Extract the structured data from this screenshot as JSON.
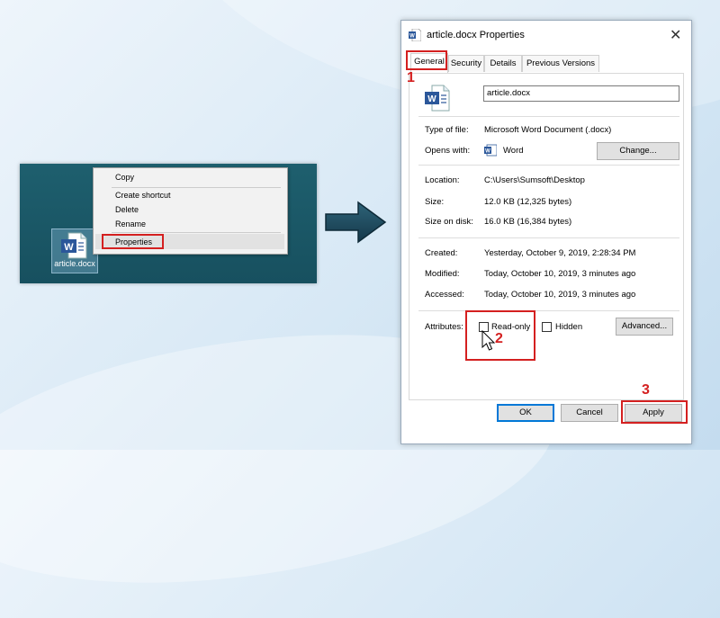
{
  "context_menu": {
    "items": [
      "Copy",
      "Create shortcut",
      "Delete",
      "Rename",
      "Properties"
    ]
  },
  "desktop": {
    "file_label": "article.docx"
  },
  "dialog": {
    "title": "article.docx Properties",
    "close_glyph": "✕",
    "tabs": [
      "General",
      "Security",
      "Details",
      "Previous Versions"
    ],
    "file_name": "article.docx",
    "type_label": "Type of file:",
    "type_value": "Microsoft Word Document (.docx)",
    "opens_label": "Opens with:",
    "opens_value": "Word",
    "change_button": "Change...",
    "location_label": "Location:",
    "location_value": "C:\\Users\\Sumsoft\\Desktop",
    "size_label": "Size:",
    "size_value": "12.0 KB (12,325 bytes)",
    "size_disk_label": "Size on disk:",
    "size_disk_value": "16.0 KB (16,384 bytes)",
    "created_label": "Created:",
    "created_value": "Yesterday, October 9, 2019, 2:28:34 PM",
    "modified_label": "Modified:",
    "modified_value": "Today, October 10, 2019, 3 minutes ago",
    "accessed_label": "Accessed:",
    "accessed_value": "Today, October 10, 2019, 3 minutes ago",
    "attributes_label": "Attributes:",
    "readonly_label": "Read-only",
    "hidden_label": "Hidden",
    "advanced_button": "Advanced...",
    "ok_button": "OK",
    "cancel_button": "Cancel",
    "apply_button": "Apply"
  },
  "steps": [
    "1",
    "2",
    "3"
  ],
  "colors": {
    "highlight": "#d42020",
    "word_blue": "#2b579a",
    "desktop": "#1e5f6e"
  }
}
